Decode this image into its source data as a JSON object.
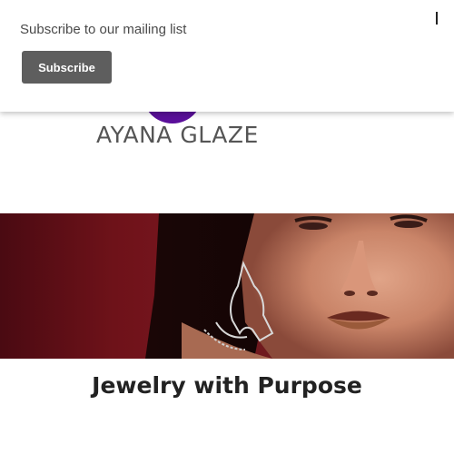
{
  "popup": {
    "message": "Subscribe to our mailing list",
    "button_label": "Subscribe"
  },
  "logo": {
    "brand_name": "AYANA GLAZE",
    "circle_color": "#5a0f9a"
  },
  "hero": {
    "image_name": "hero-model-earring-photo"
  },
  "main": {
    "heading": "Jewelry with Purpose"
  },
  "colors": {
    "button_bg": "#5e5e5e",
    "text_dark": "#222222"
  }
}
